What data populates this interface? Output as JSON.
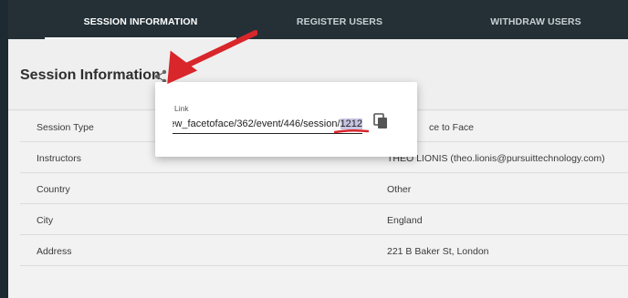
{
  "nav": {
    "tabs": [
      {
        "label": "SESSION INFORMATION",
        "active": true
      },
      {
        "label": "REGISTER USERS",
        "active": false
      },
      {
        "label": "WITHDRAW USERS",
        "active": false
      }
    ]
  },
  "section": {
    "title": "Session Information",
    "share_icon": "share-icon"
  },
  "popup": {
    "label": "Link",
    "link_prefix": "ew_facetoface/362/event/446/session/",
    "link_selected": "1212",
    "copy_icon": "copy-icon"
  },
  "details": {
    "rows": [
      {
        "label": "Session Type",
        "value": "ce to Face"
      },
      {
        "label": "Instructors",
        "value": "THEO LIONIS (theo.lionis@pursuittechnology.com)"
      },
      {
        "label": "Country",
        "value": "Other"
      },
      {
        "label": "City",
        "value": "England"
      },
      {
        "label": "Address",
        "value": "221 B Baker St, London"
      }
    ]
  },
  "annotations": {
    "arrow_color": "#d8262b",
    "underline_color": "#d8262b"
  },
  "colors": {
    "navbar": "#243036",
    "background": "#ececec"
  }
}
